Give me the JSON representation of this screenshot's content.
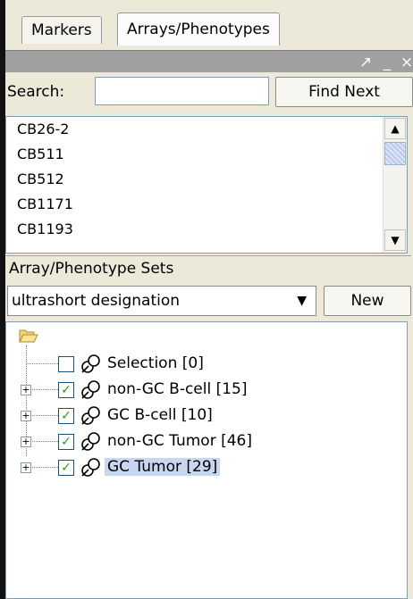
{
  "tabs": [
    {
      "label": "Markers"
    },
    {
      "label": "Arrays/Phenotypes"
    }
  ],
  "titlebar": {
    "controls": [
      "↗",
      "_",
      "×"
    ]
  },
  "search": {
    "label": "Search:",
    "value": "",
    "placeholder": "",
    "find_next_label": "Find Next"
  },
  "list": {
    "items": [
      "CB26-2",
      "CB511",
      "CB512",
      "CB1171",
      "CB1193"
    ]
  },
  "sets": {
    "header": "Array/Phenotype Sets",
    "selected_option": "ultrashort designation",
    "new_label": "New",
    "tree": [
      {
        "label": "Selection [0]",
        "checked": false,
        "expandable": false
      },
      {
        "label": "non-GC B-cell [15]",
        "checked": true,
        "expandable": true
      },
      {
        "label": "GC B-cell [10]",
        "checked": true,
        "expandable": true
      },
      {
        "label": "non-GC Tumor [46]",
        "checked": true,
        "expandable": true
      },
      {
        "label": "GC Tumor [29]",
        "checked": true,
        "expandable": true,
        "selected": true
      }
    ]
  }
}
